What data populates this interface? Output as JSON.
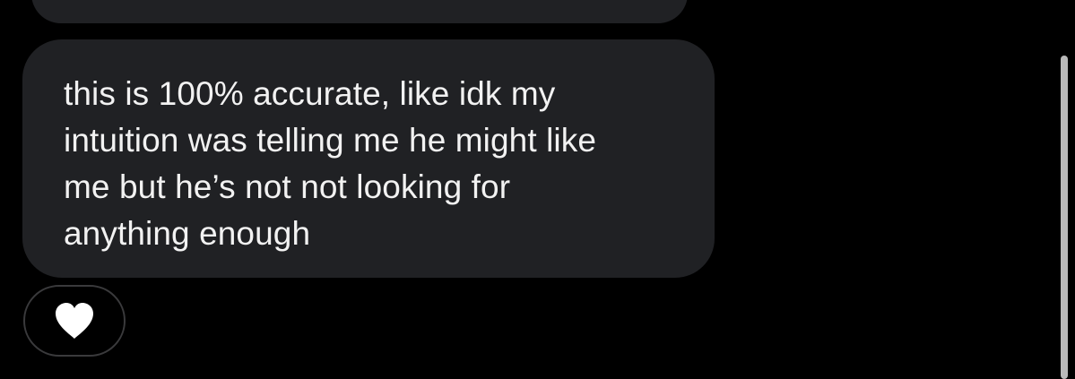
{
  "conversation": {
    "message": {
      "text": "this is 100% accurate, like idk my\nintuition was telling me he might like\nme but he’s not not looking for\nanything enough"
    },
    "reaction": {
      "icon": "white-heart-icon",
      "color": "#ffffff"
    }
  },
  "colors": {
    "background": "#000000",
    "bubble": "#202124",
    "text": "#f2f2f2",
    "reaction_border": "#3a3a3c",
    "scrollbar": "#b9b9b9"
  }
}
